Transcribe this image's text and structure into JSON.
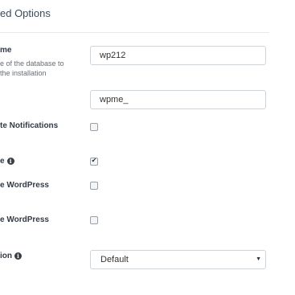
{
  "section": {
    "title": "ed Options"
  },
  "fields": {
    "table_prefix_name": {
      "label": "me",
      "help_line1": "e of the database to",
      "help_line2": "the installation",
      "value": "wp212"
    },
    "table_prefix": {
      "value": "wpme_"
    },
    "update_notifications": {
      "label": "te Notifications",
      "checked": false
    },
    "option_info": {
      "label": "e",
      "checked": true
    },
    "wordpress_option_1": {
      "label": "e WordPress",
      "checked": false
    },
    "wordpress_option_2": {
      "label": "e WordPress",
      "checked": false
    },
    "select_option": {
      "label": "ion",
      "selected": "Default"
    }
  },
  "icons": {
    "info": "info-icon",
    "check": "check-icon",
    "dropdown": "caret-down-icon"
  },
  "colors": {
    "title": "#3c4a57",
    "divider": "#e7e9ec",
    "input_border": "#cfd4d9"
  }
}
